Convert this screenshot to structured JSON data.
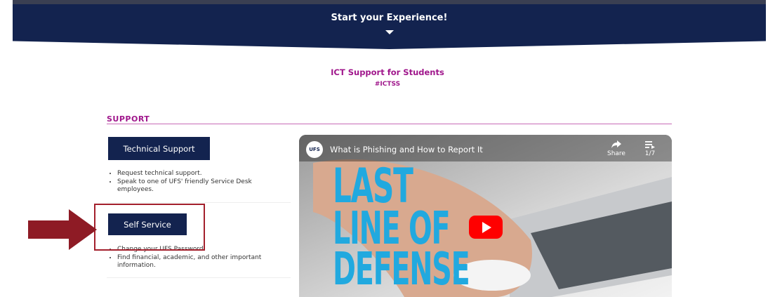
{
  "banner": {
    "title": "Start your Experience!"
  },
  "page": {
    "heading": "ICT Support for Students",
    "hashtag": "#ICTSS"
  },
  "support": {
    "label": "SUPPORT",
    "technical": {
      "button": "Technical Support",
      "bullets": [
        "Request technical support.",
        "Speak to one of UFS' friendly Service Desk employees."
      ]
    },
    "self_service": {
      "button": "Self Service",
      "bullets": [
        "Change your UFS Password.",
        "Find financial, academic, and other important information."
      ]
    }
  },
  "video": {
    "title": "What is Phishing and How to Report It",
    "channel_logo": "UFS",
    "share_label": "Share",
    "playlist_count": "1/7",
    "overlay_lines": [
      "LAST",
      "LINE OF",
      "DEFENSE"
    ]
  },
  "colors": {
    "navy": "#13234f",
    "accent": "#a0178c",
    "highlight": "#a3202c",
    "video_text": "#21a9df"
  },
  "icons": {
    "banner": "caret-down-icon",
    "share": "share-icon",
    "playlist": "playlist-icon",
    "play": "play-icon",
    "annotation": "arrow-right-icon"
  }
}
